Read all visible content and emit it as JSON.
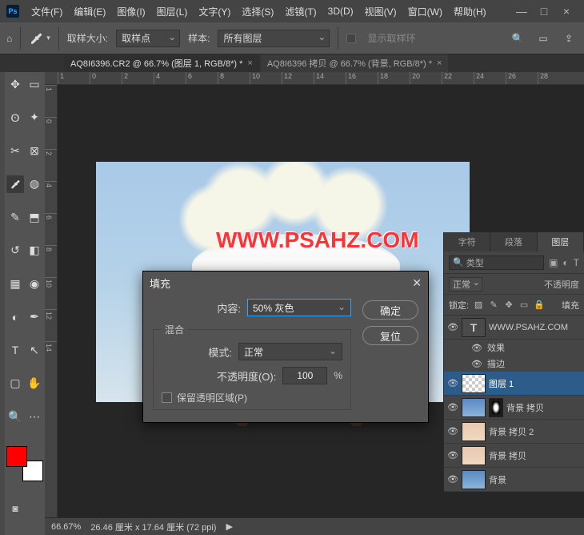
{
  "app_logo": "Ps",
  "menu": {
    "file": "文件(F)",
    "edit": "编辑(E)",
    "image": "图像(I)",
    "layer": "图层(L)",
    "type": "文字(Y)",
    "select": "选择(S)",
    "filter": "滤镜(T)",
    "threeD": "3D(D)",
    "view": "视图(V)",
    "window": "窗口(W)",
    "help": "帮助(H)"
  },
  "window_btns": {
    "min": "—",
    "max": "□",
    "close": "×"
  },
  "options": {
    "sample_size_label": "取样大小:",
    "sample_size_value": "取样点",
    "sample_label": "样本:",
    "sample_value": "所有图层",
    "ring_label": "显示取样环"
  },
  "tabs": {
    "t1": "AQ8I6396.CR2 @ 66.7% (图层 1, RGB/8*) *",
    "t2": "AQ8I6396 拷贝 @ 66.7% (背景, RGB/8*) *"
  },
  "ruler_h": [
    "1",
    "0",
    "2",
    "4",
    "6",
    "8",
    "10",
    "12",
    "14",
    "16",
    "18",
    "20",
    "22",
    "24",
    "26",
    "28"
  ],
  "ruler_v": [
    "1",
    "0",
    "2",
    "4",
    "6",
    "8",
    "10",
    "12",
    "14"
  ],
  "status": {
    "zoom": "66.67%",
    "info": "26.46 厘米 x 17.64 厘米 (72 ppi)",
    "arrow": "▶"
  },
  "watermark": "WWW.PSAHZ.COM",
  "dialog": {
    "title": "填充",
    "close": "✕",
    "content_label": "内容:",
    "content_value": "50% 灰色",
    "blend_legend": "混合",
    "mode_label": "模式:",
    "mode_value": "正常",
    "opacity_label": "不透明度(O):",
    "opacity_value": "100",
    "percent": "%",
    "preserve_label": "保留透明区域(P)",
    "ok": "确定",
    "reset": "复位"
  },
  "panel": {
    "tabs": {
      "char": "字符",
      "para": "段落",
      "layers": "图层"
    },
    "kind_label": "类型",
    "blend": "正常",
    "opacity_label": "不透明度",
    "lock_label": "锁定:",
    "fill_label": "填充",
    "search_icon": "🔍",
    "layers": {
      "text_layer": "WWW.PSAHZ.COM",
      "fx": "效果",
      "stroke": "描边",
      "l1": "图层 1",
      "bgcopy3": "背景 拷贝",
      "bgcopy2": "背景 拷贝 2",
      "bgcopy": "背景 拷贝",
      "bg": "背景"
    }
  }
}
